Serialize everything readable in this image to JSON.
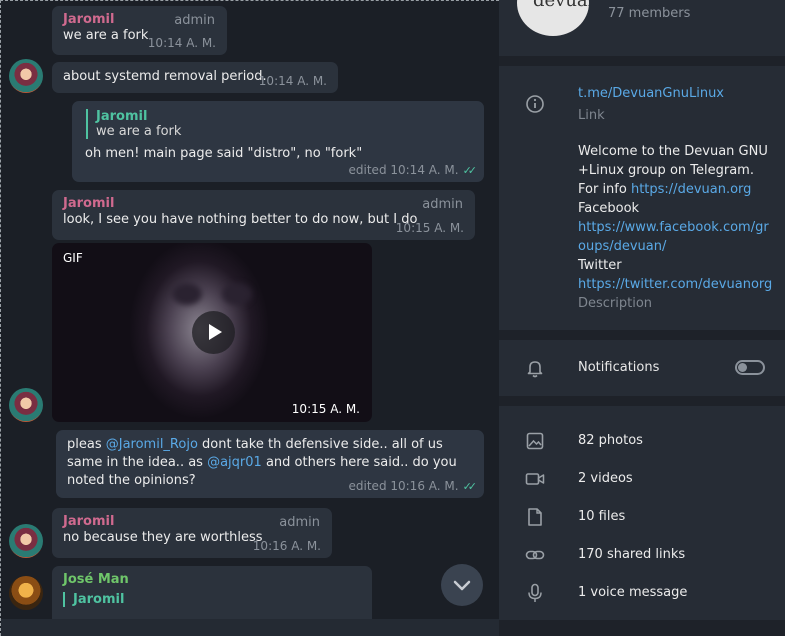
{
  "chat": {
    "messages": [
      {
        "sender": "Jaromil",
        "role": "admin",
        "text": "we are a fork",
        "time": "10:14 A. M."
      },
      {
        "text": "about systemd removal period.",
        "time": "10:14 A. M."
      },
      {
        "quote_name": "Jaromil",
        "quote_text": "we are a fork",
        "text": "oh men! main page said \"distro\", no \"fork\"",
        "time": "edited 10:14 A. M."
      },
      {
        "sender": "Jaromil",
        "role": "admin",
        "text": "look, I see you have nothing better to do now, but I do",
        "time": "10:15 A. M."
      },
      {
        "gif_label": "GIF",
        "time": "10:15 A. M."
      },
      {
        "text_a": "pleas ",
        "mention1": "@Jaromil_Rojo",
        "text_b": "  dont take th defensive side.. all of us same in the idea.. as ",
        "mention2": "@ajqr01",
        "text_c": "  and others here said.. do you noted the opinions?",
        "time": "edited 10:16 A. M."
      },
      {
        "sender": "Jaromil",
        "role": "admin",
        "text": "no because they are worthless",
        "time": "10:16 A. M."
      },
      {
        "sender": "José Man",
        "quote_name": "Jaromil"
      }
    ]
  },
  "info": {
    "members": "77 members",
    "group_logo_text": "devuan",
    "link": "t.me/DevuanGnuLinux",
    "link_caption": "Link",
    "description": {
      "p1": "Welcome to the Devuan GNU +Linux group on Telegram. For info ",
      "url1": "https://devuan.org",
      "facebook": "Facebook",
      "url2": "https://www.facebook.com/groups/devuan/",
      "twitter": "Twitter",
      "url3": "https://twitter.com/devuanorg",
      "caption": "Description"
    },
    "notifications_label": "Notifications",
    "notifications_on": false,
    "media": [
      {
        "icon": "photo-icon",
        "label": "82 photos"
      },
      {
        "icon": "video-icon",
        "label": "2 videos"
      },
      {
        "icon": "file-icon",
        "label": "10 files"
      },
      {
        "icon": "link-icon",
        "label": "170 shared links"
      },
      {
        "icon": "microphone-icon",
        "label": "1 voice message"
      }
    ]
  },
  "colors": {
    "accent": "#4fc3a1",
    "link": "#5aa9e6",
    "admin_name": "#d06a8f",
    "other_name": "#6fc66a"
  }
}
